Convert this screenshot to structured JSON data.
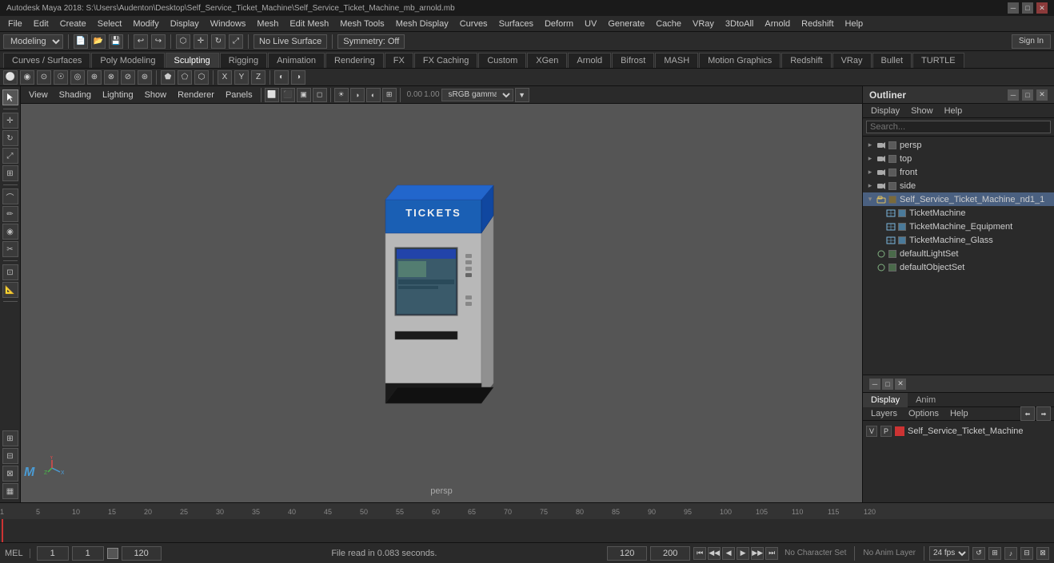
{
  "titlebar": {
    "title": "Autodesk Maya 2018: S:\\Users\\Audenton\\Desktop\\Self_Service_Ticket_Machine\\Self_Service_Ticket_Machine_mb_arnold.mb",
    "minimize": "─",
    "maximize": "□",
    "close": "✕"
  },
  "menubar": {
    "items": [
      "File",
      "Edit",
      "Create",
      "Select",
      "Modify",
      "Display",
      "Windows",
      "Mesh",
      "Edit Mesh",
      "Mesh Tools",
      "Mesh Display",
      "Curves",
      "Surfaces",
      "Deform",
      "UV",
      "Generate",
      "Cache",
      "V-Ray",
      "3DtoAll--",
      "Arnold",
      "Redshift",
      "Help"
    ]
  },
  "modulerow": {
    "module": "Modeling",
    "symmetry": "Symmetry: Off",
    "no_live": "No Live Surface",
    "sign_in": "Sign In"
  },
  "tabs": {
    "items": [
      "Curves / Surfaces",
      "Poly Modeling",
      "Sculpting",
      "Rigging",
      "Animation",
      "Rendering",
      "FX",
      "FX Caching",
      "Custom",
      "XGen",
      "Arnold",
      "Bifrost",
      "MASH",
      "Motion Graphics",
      "Redshift",
      "VRay",
      "Bullet",
      "TURTLE"
    ]
  },
  "viewport": {
    "label": "persp",
    "viewmenu": [
      "View",
      "Shading",
      "Lighting",
      "Show",
      "Renderer",
      "Panels"
    ]
  },
  "outliner": {
    "title": "Outliner",
    "menu": [
      "Display",
      "Show",
      "Help"
    ],
    "search_placeholder": "Search...",
    "tree": [
      {
        "label": "persp",
        "indent": 0,
        "icon": "camera",
        "type": "camera"
      },
      {
        "label": "top",
        "indent": 0,
        "icon": "camera",
        "type": "camera"
      },
      {
        "label": "front",
        "indent": 0,
        "icon": "camera",
        "type": "camera"
      },
      {
        "label": "side",
        "indent": 0,
        "icon": "camera",
        "type": "camera"
      },
      {
        "label": "Self_Service_Ticket_Machine_nd1_1",
        "indent": 0,
        "icon": "group",
        "type": "group",
        "selected": true
      },
      {
        "label": "TicketMachine",
        "indent": 1,
        "icon": "mesh",
        "type": "mesh"
      },
      {
        "label": "TicketMachine_Equipment",
        "indent": 1,
        "icon": "mesh",
        "type": "mesh"
      },
      {
        "label": "TicketMachine_Glass",
        "indent": 1,
        "icon": "mesh",
        "type": "mesh"
      },
      {
        "label": "defaultLightSet",
        "indent": 0,
        "icon": "set",
        "type": "set"
      },
      {
        "label": "defaultObjectSet",
        "indent": 0,
        "icon": "set",
        "type": "set"
      }
    ]
  },
  "bottom_outliner": {
    "tabs": [
      "Display",
      "Anim"
    ],
    "active_tab": "Display",
    "menu": [
      "Layers",
      "Options",
      "Help"
    ],
    "layer": {
      "v": "V",
      "p": "P",
      "color": "#cc3333",
      "name": "Self_Service_Ticket_Machine"
    }
  },
  "timeline": {
    "start": "1",
    "current_frame": "1",
    "end_display": "120",
    "range_start": "1",
    "range_end": "200",
    "fps": "24 fps",
    "ticks": [
      "1",
      "5",
      "10",
      "15",
      "20",
      "25",
      "30",
      "35",
      "40",
      "45",
      "50",
      "55",
      "60",
      "65",
      "70",
      "75",
      "80",
      "85",
      "90",
      "95",
      "100",
      "105",
      "110",
      "115",
      "120"
    ]
  },
  "bottombar": {
    "mode": "MEL",
    "status": "File read in  0.083 seconds.",
    "no_char_set": "No Character Set",
    "no_anim_layer": "No Anim Layer",
    "current_time": "120",
    "range_end": "200"
  },
  "playback": {
    "buttons": [
      "⏮",
      "◀◀",
      "◀",
      "▶",
      "▶▶",
      "⏭"
    ]
  },
  "colors": {
    "accent_blue": "#4a9bd4",
    "bg_dark": "#2a2a2a",
    "bg_mid": "#333333",
    "bg_viewport": "#555555",
    "selected": "#4a6080"
  }
}
